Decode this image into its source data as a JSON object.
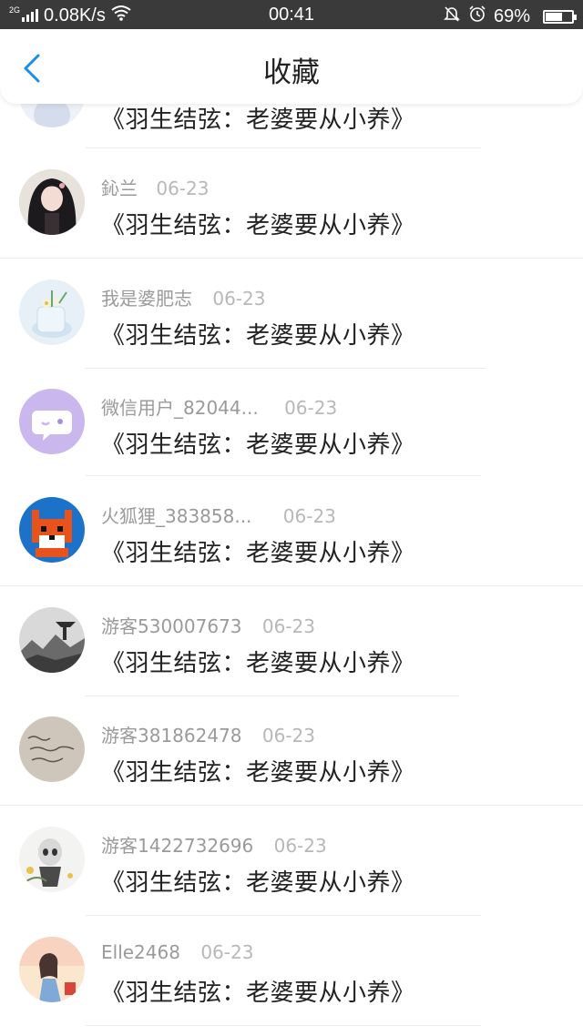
{
  "status_bar": {
    "network_badge": "2G",
    "speed": "0.08K/s",
    "time": "00:41",
    "battery_percent": "69%",
    "battery_level": 0.69,
    "icons": [
      "signal-icon",
      "wifi-icon",
      "mute-bell-icon",
      "alarm-icon",
      "battery-icon"
    ]
  },
  "nav": {
    "back_icon": "chevron-left-icon",
    "title": "收藏",
    "accent_color": "#1a8fe8"
  },
  "items": [
    {
      "user": "",
      "date": "",
      "title": "《羽生结弦：老婆要从小养》",
      "avatar": "white-figure"
    },
    {
      "user": "鈊兰",
      "date": "06-23",
      "title": "《羽生结弦：老婆要从小养》",
      "avatar": "dark-hair-girl"
    },
    {
      "user": "我是婆肥志",
      "date": "06-23",
      "title": "《羽生结弦：老婆要从小养》",
      "avatar": "flower-glass"
    },
    {
      "user": "微信用户_82044...",
      "date": "06-23",
      "title": "《羽生结弦：老婆要从小养》",
      "avatar": "chat-bubble"
    },
    {
      "user": "火狐狸_383858...",
      "date": "06-23",
      "title": "《羽生结弦：老婆要从小养》",
      "avatar": "pixel-fox"
    },
    {
      "user": "游客530007673",
      "date": "06-23",
      "title": "《羽生结弦：老婆要从小养》",
      "avatar": "ink-landscape"
    },
    {
      "user": "游客381862478",
      "date": "06-23",
      "title": "《羽生结弦：老婆要从小养》",
      "avatar": "handwriting"
    },
    {
      "user": "游客1422732696",
      "date": "06-23",
      "title": "《羽生结弦：老婆要从小养》",
      "avatar": "skeleton-art"
    },
    {
      "user": "Elle2468",
      "date": "06-23",
      "title": "《羽生结弦：老婆要从小养》",
      "avatar": "pastel-girl"
    }
  ]
}
